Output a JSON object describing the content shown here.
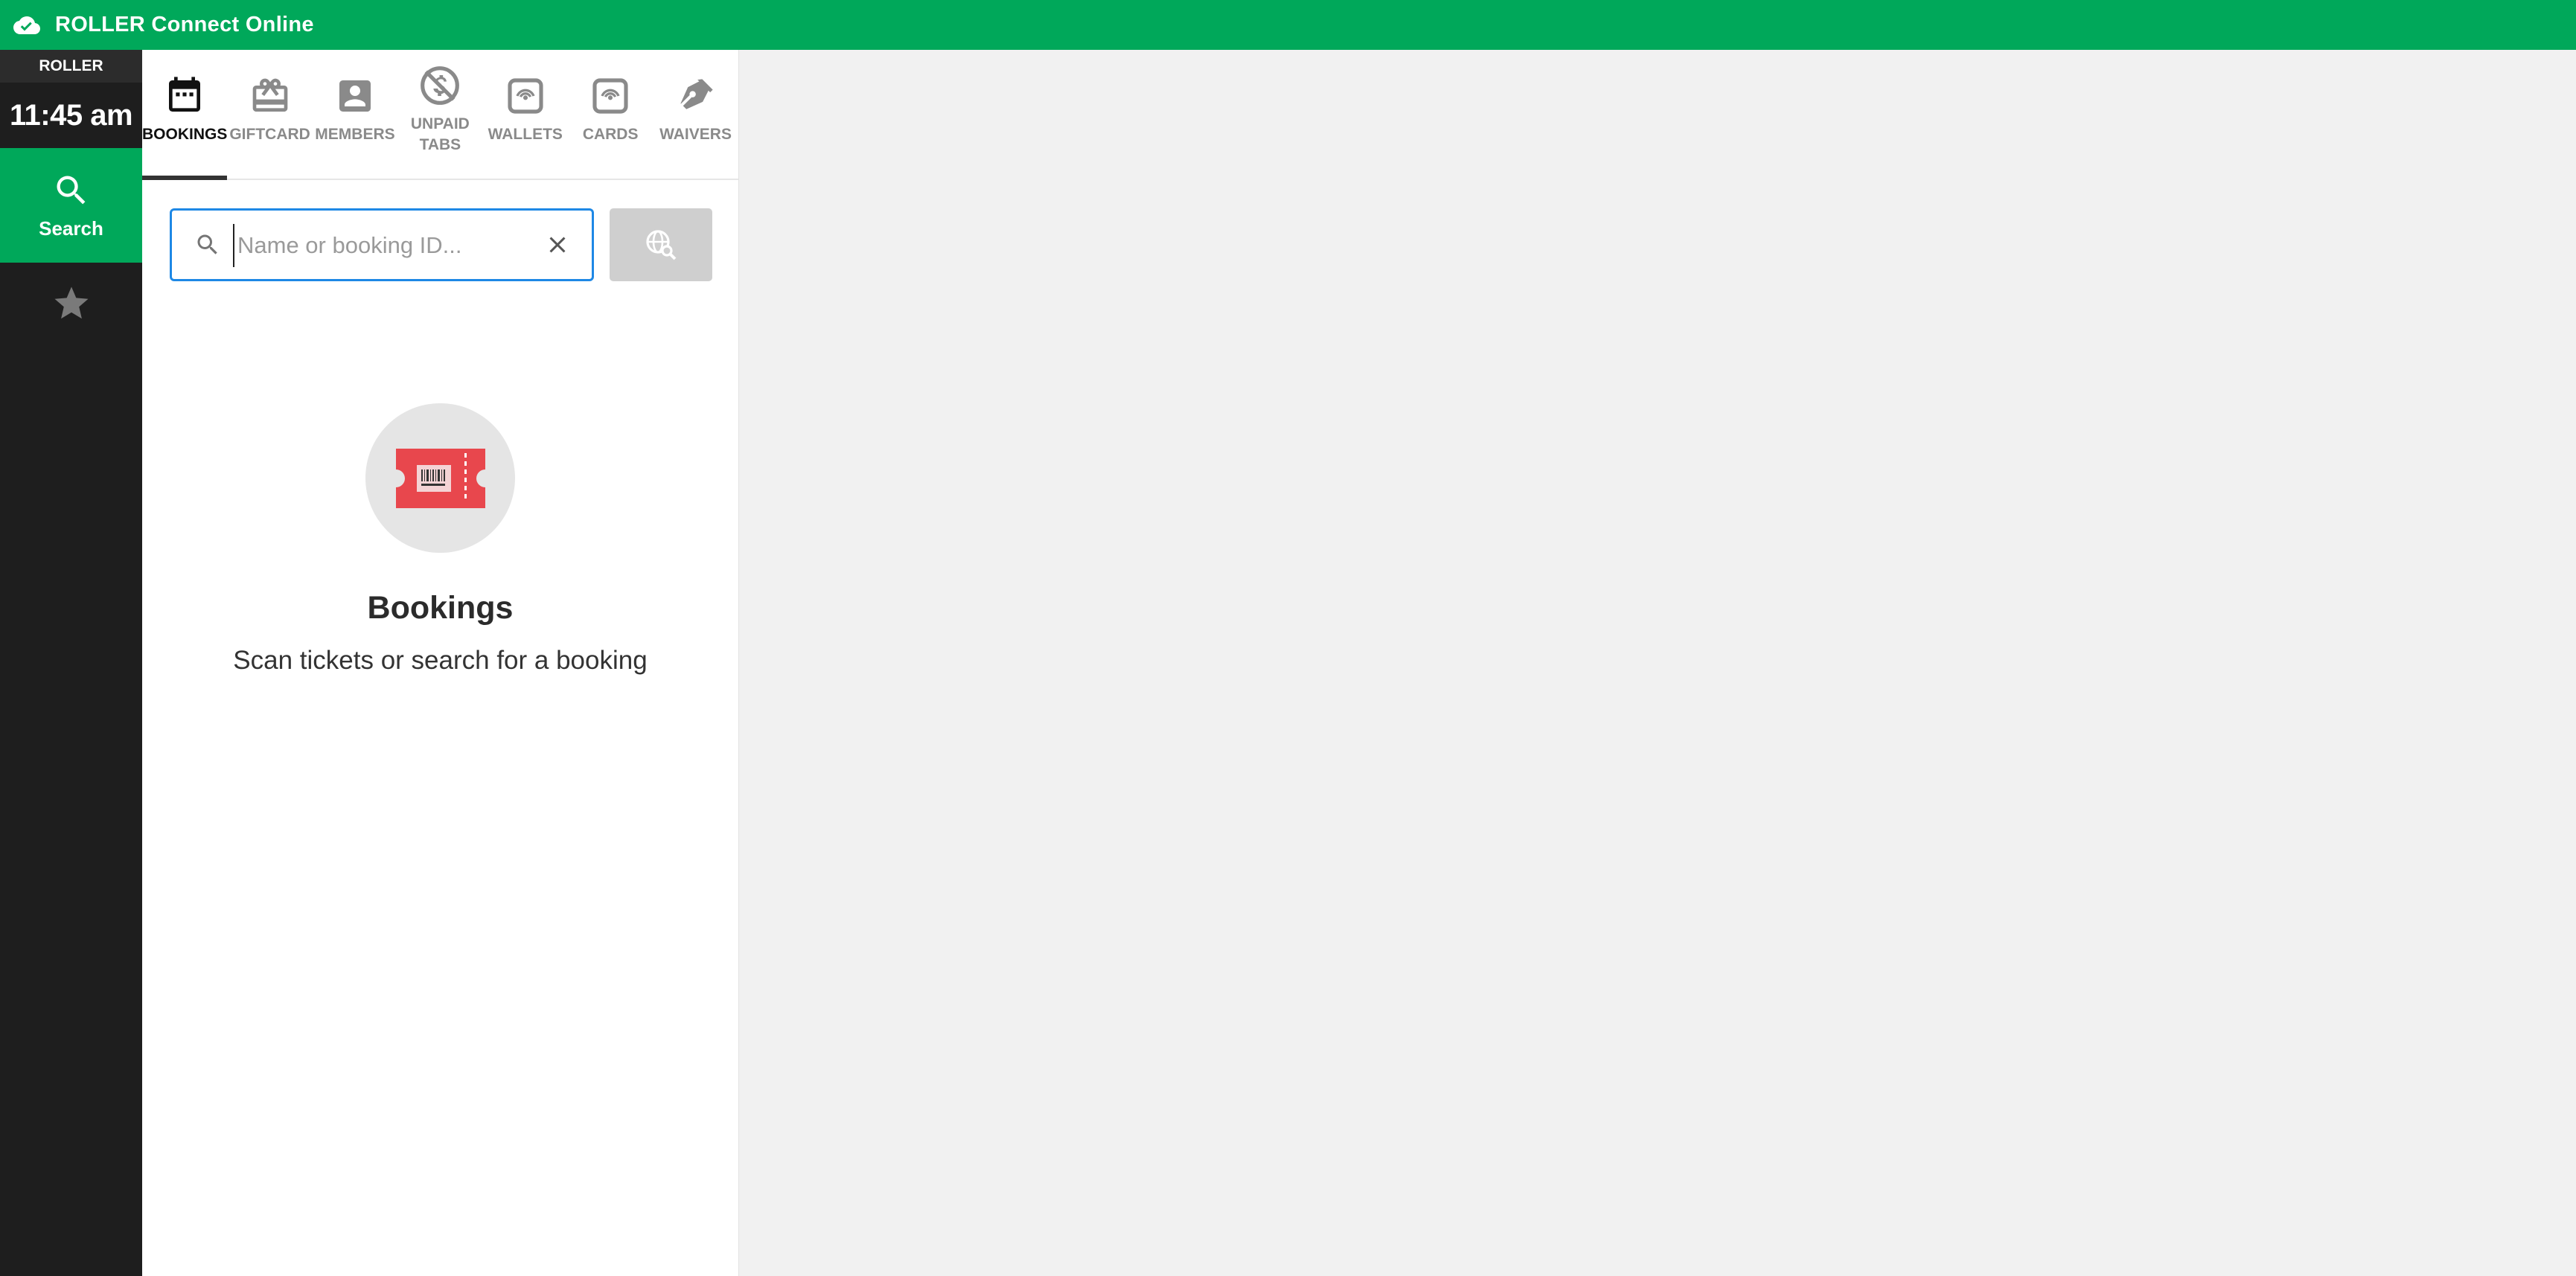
{
  "topbar": {
    "title": "ROLLER Connect Online",
    "icon": "cloud-check-icon"
  },
  "rail": {
    "brand": "ROLLER",
    "time": "11:45 am",
    "nav": [
      {
        "label": "Search",
        "icon": "search-icon",
        "active": true
      },
      {
        "label": "",
        "icon": "star-icon",
        "active": false
      }
    ]
  },
  "tabs": [
    {
      "label": "BOOKINGS",
      "icon": "calendar-icon",
      "active": true
    },
    {
      "label": "GIFTCARD",
      "icon": "gift-card-icon",
      "active": false
    },
    {
      "label": "MEMBERS",
      "icon": "member-icon",
      "active": false
    },
    {
      "label": "UNPAID\nTABS",
      "icon": "unpaid-tabs-icon",
      "active": false
    },
    {
      "label": "WALLETS",
      "icon": "wallet-icon",
      "active": false
    },
    {
      "label": "CARDS",
      "icon": "card-icon",
      "active": false
    },
    {
      "label": "WAIVERS",
      "icon": "pen-icon",
      "active": false
    }
  ],
  "search": {
    "placeholder": "Name or booking ID...",
    "value": ""
  },
  "empty_state": {
    "icon": "ticket-icon",
    "heading": "Bookings",
    "message": "Scan tickets or search for a booking"
  },
  "colors": {
    "brand_green": "#00a85a",
    "rail_dark": "#1e1e1e",
    "focus_blue": "#1e88e5",
    "ticket_red": "#e8474d"
  }
}
